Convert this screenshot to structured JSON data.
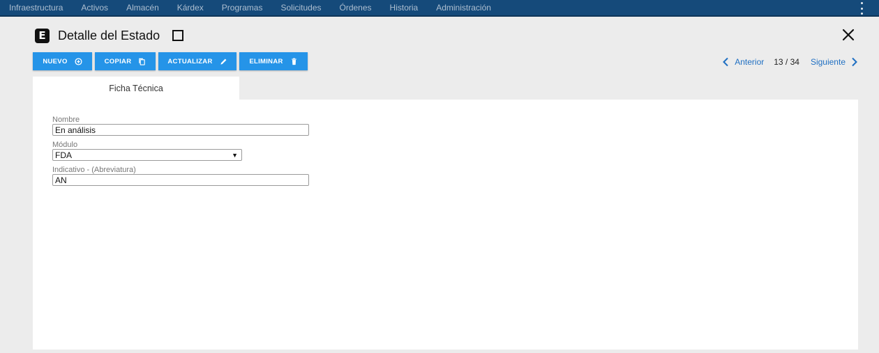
{
  "topnav": {
    "items": [
      "Infraestructura",
      "Activos",
      "Almacén",
      "Kárdex",
      "Programas",
      "Solicitudes",
      "Órdenes",
      "Historia",
      "Administración"
    ],
    "menu_icon": "kebab-menu-icon"
  },
  "header": {
    "logo_letter": "E",
    "title": "Detalle del Estado",
    "close_icon": "close-icon"
  },
  "toolbar": {
    "nuevo": "NUEVO",
    "copiar": "COPIAR",
    "actualizar": "ACTUALIZAR",
    "eliminar": "ELIMINAR",
    "button_color": "#2594e8"
  },
  "pager": {
    "prev": "Anterior",
    "count": "13 / 34",
    "next": "Siguiente"
  },
  "tabs": [
    {
      "label": "Ficha Técnica",
      "active": true
    }
  ],
  "form": {
    "nombre_label": "Nombre",
    "nombre_value": "En análisis",
    "modulo_label": "Módulo",
    "modulo_value": "FDA",
    "indicativo_label": "Indicativo - (Abreviatura)",
    "indicativo_value": "AN"
  },
  "colors": {
    "topbar": "#154a7a",
    "link": "#1f6fc2",
    "background": "#ececec"
  }
}
